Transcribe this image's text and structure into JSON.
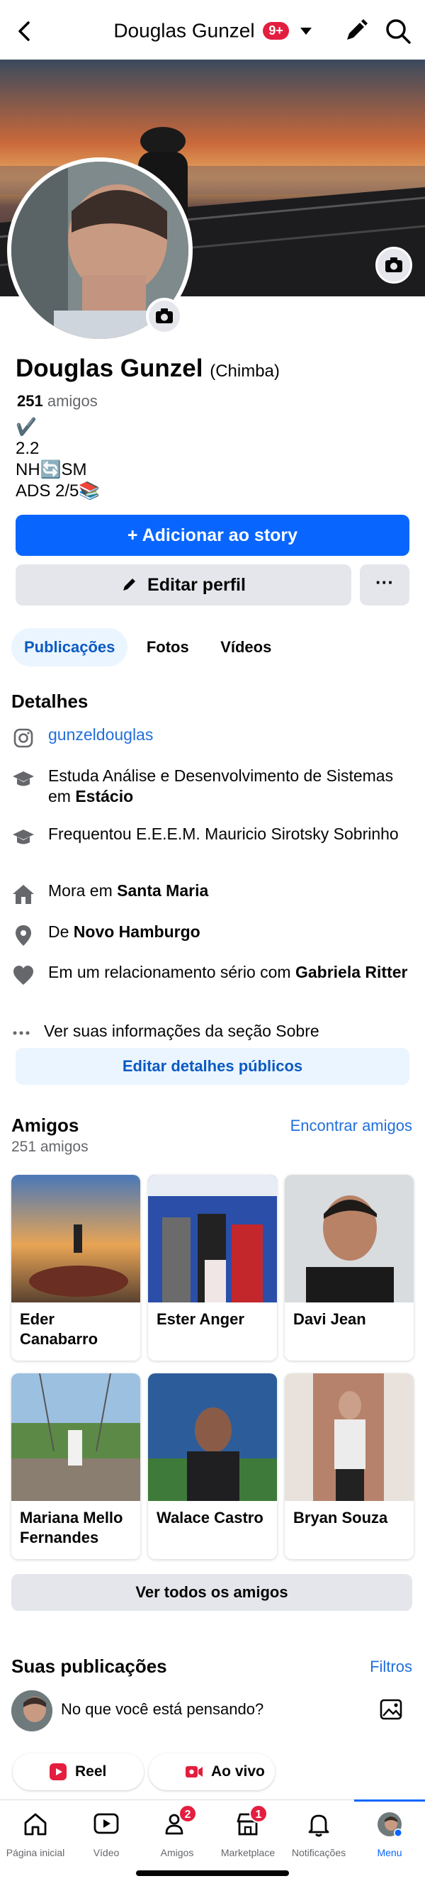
{
  "header": {
    "title": "Douglas Gunzel",
    "notif_badge": "9+"
  },
  "profile": {
    "name": "Douglas Gunzel",
    "nickname": "(Chimba)",
    "friends_count": "251",
    "friends_word": "amigos",
    "bio_lines": [
      "✔️",
      "2.2",
      "NH🔄SM",
      "ADS 2/5📚"
    ]
  },
  "actions": {
    "add_story": "Adicionar ao story",
    "edit_profile": "Editar perfil",
    "more": "···"
  },
  "tabs": [
    {
      "label": "Publicações",
      "active": true
    },
    {
      "label": "Fotos",
      "active": false
    },
    {
      "label": "Vídeos",
      "active": false
    }
  ],
  "details": {
    "title": "Detalhes",
    "instagram": "gunzeldouglas",
    "study_prefix": "Estuda Análise e Desenvolvimento de Sistemas em ",
    "study_place": "Estácio",
    "school": "Frequentou E.E.E.M. Mauricio Sirotsky Sobrinho",
    "lives_prefix": "Mora em ",
    "lives_place": "Santa Maria",
    "from_prefix": "De ",
    "from_place": "Novo Hamburgo",
    "relationship_prefix": "Em um relacionamento sério com ",
    "relationship_partner": "Gabriela Ritter",
    "see_about": "Ver suas informações da seção Sobre",
    "edit_public": "Editar detalhes públicos"
  },
  "friends": {
    "title": "Amigos",
    "find_link": "Encontrar amigos",
    "subtitle": "251 amigos",
    "list": [
      {
        "name": "Eder Canabarro"
      },
      {
        "name": "Ester Anger"
      },
      {
        "name": "Davi Jean"
      },
      {
        "name": "Mariana Mello Fernandes"
      },
      {
        "name": "Walace Castro"
      },
      {
        "name": "Bryan Souza"
      }
    ],
    "see_all": "Ver todos os amigos"
  },
  "posts": {
    "title": "Suas publicações",
    "filters": "Filtros",
    "composer_placeholder": "No que você está pensando?",
    "reel": "Reel",
    "live": "Ao vivo"
  },
  "bottom_nav": [
    {
      "label": "Página inicial",
      "icon": "home-icon"
    },
    {
      "label": "Vídeo",
      "icon": "video-icon"
    },
    {
      "label": "Amigos",
      "icon": "friends-icon",
      "badge": "2"
    },
    {
      "label": "Marketplace",
      "icon": "marketplace-icon",
      "badge": "1"
    },
    {
      "label": "Notificações",
      "icon": "bell-icon"
    },
    {
      "label": "Menu",
      "icon": "menu-avatar-icon",
      "active": true
    }
  ],
  "colors": {
    "brand_blue": "#0866ff",
    "link_blue": "#216fdb",
    "badge_red": "#e41e3f",
    "button_gray": "#e4e6eb",
    "light_blue": "#ebf5ff"
  }
}
